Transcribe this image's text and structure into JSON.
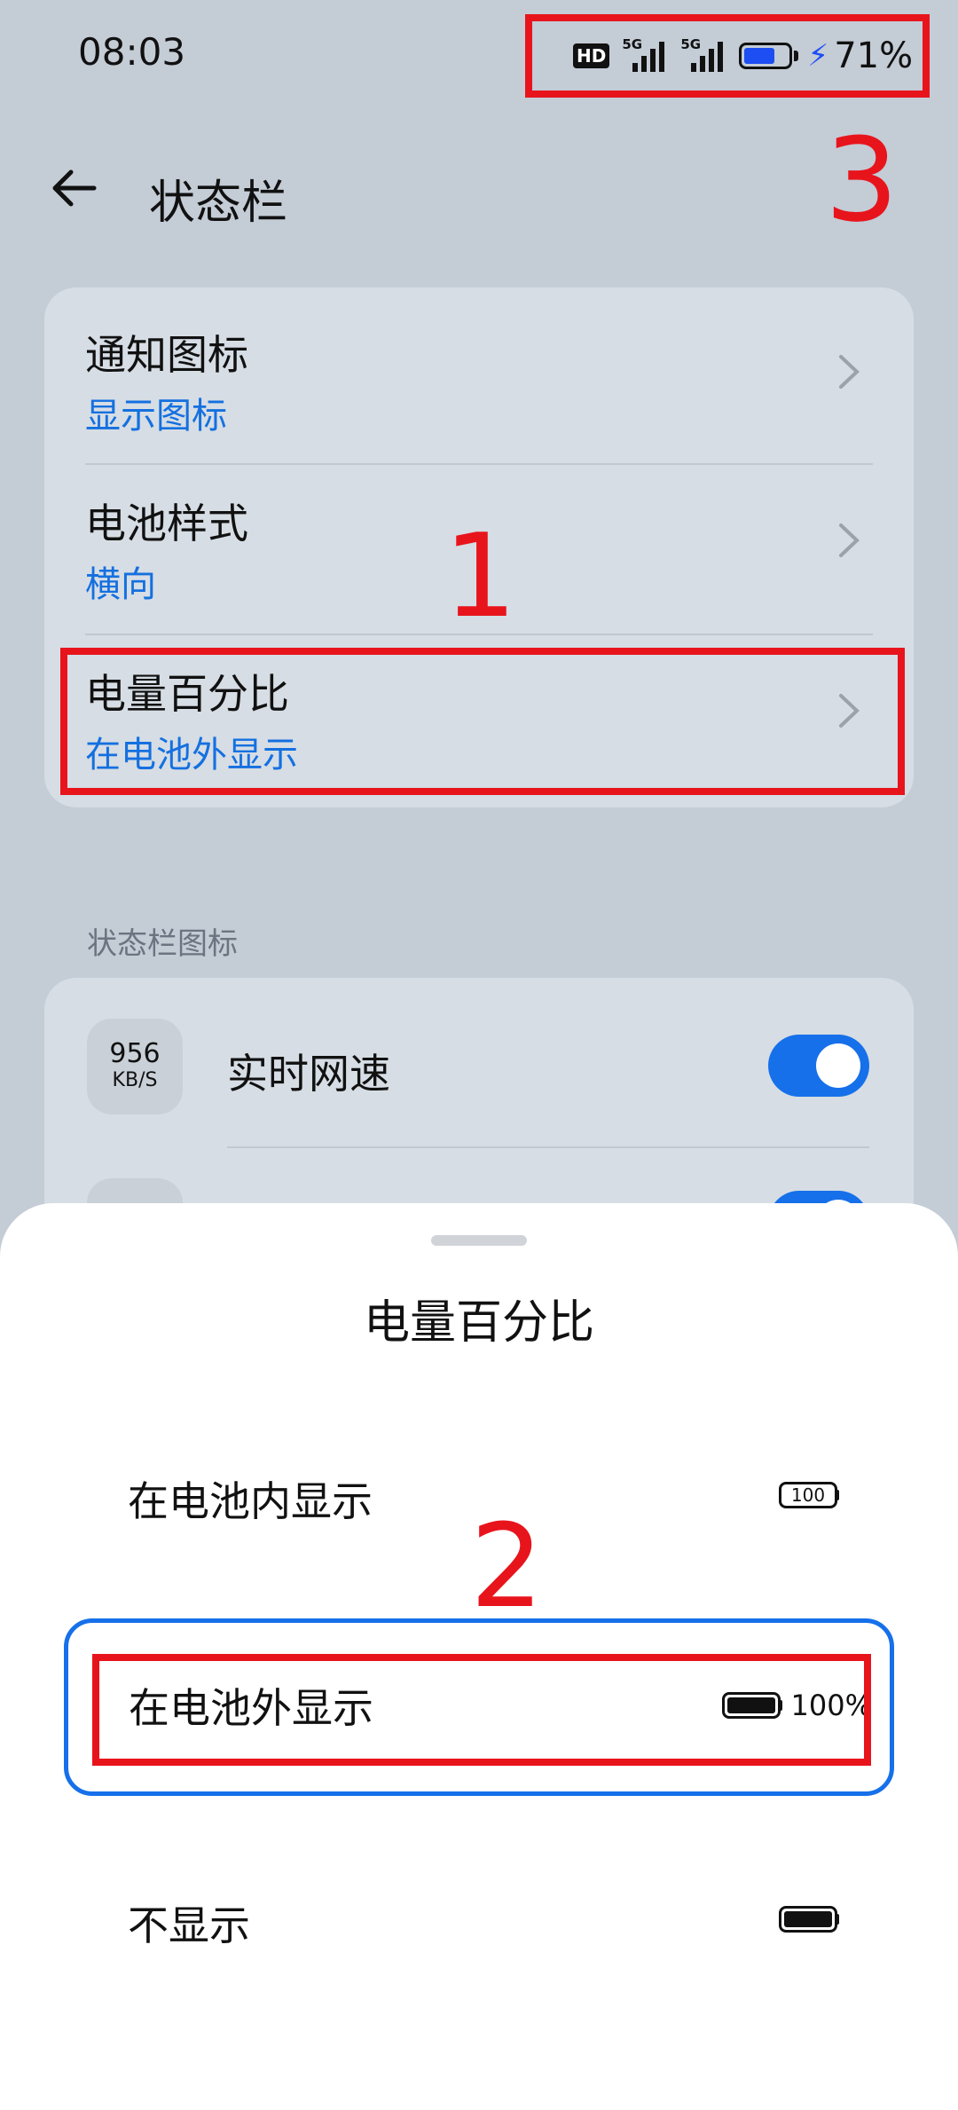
{
  "status_bar": {
    "time": "08:03",
    "hd_label": "HD",
    "network_1": "5G",
    "network_2": "5G",
    "battery_level": 0.71,
    "battery_percent": "71%",
    "charging_icon": "bolt-icon",
    "accent_color": "#1d4ef3"
  },
  "header": {
    "back_icon": "back-arrow-icon",
    "title": "状态栏"
  },
  "settings": [
    {
      "title": "通知图标",
      "value": "显示图标"
    },
    {
      "title": "电池样式",
      "value": "横向"
    },
    {
      "title": "电量百分比",
      "value": "在电池外显示"
    }
  ],
  "section_label": "状态栏图标",
  "status_icons": {
    "net_speed_tile_value": "956",
    "net_speed_tile_unit": "KB/S",
    "net_speed_label": "实时网速",
    "net_speed_enabled": true
  },
  "sheet": {
    "title": "电量百分比",
    "options": [
      {
        "label": "在电池内显示",
        "preview_text": "100",
        "selected": false
      },
      {
        "label": "在电池外显示",
        "preview_text": "100%",
        "selected": true
      },
      {
        "label": "不显示",
        "preview_text": "",
        "selected": false
      }
    ]
  },
  "annotations": {
    "marker_1": "1",
    "marker_2": "2",
    "marker_3": "3",
    "color": "#e8141c"
  },
  "colors": {
    "link_blue": "#1470e0",
    "toggle_blue": "#1670ea"
  }
}
